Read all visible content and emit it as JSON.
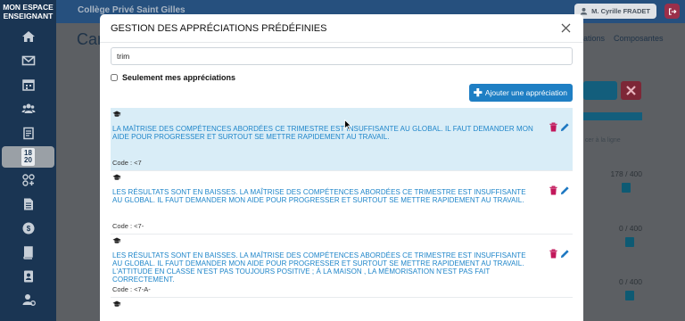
{
  "brand": {
    "line1": "MON ESPACE",
    "line2": "ENSEIGNANT"
  },
  "sidebar": {
    "date_badge": {
      "day": "18",
      "month": "20"
    },
    "items": [
      {
        "icon": "home-icon"
      },
      {
        "icon": "mail-icon"
      },
      {
        "icon": "calendar-icon"
      },
      {
        "icon": "users-icon"
      },
      {
        "icon": "clipboard-icon"
      },
      {
        "icon": "date-badge"
      },
      {
        "icon": "grid-icon"
      },
      {
        "icon": "document-icon"
      },
      {
        "icon": "coin-icon"
      },
      {
        "icon": "book-icon"
      },
      {
        "icon": "contact-icon"
      },
      {
        "icon": "user-settings-icon"
      }
    ]
  },
  "topbar": {
    "college": "Collège Privé Saint Gilles",
    "user": "M. Cyrille FRADET"
  },
  "background": {
    "page_title": "Car",
    "tab_appreciations": "ations",
    "tab_composantes": "Composantes",
    "line_hint": "cer à la ligne",
    "scores": [
      "178 / 400",
      "0 / 400",
      "0 / 400"
    ],
    "colors": {
      "teal": "#135e7c",
      "red": "#7d2737",
      "navy": "#1a3553"
    }
  },
  "modal": {
    "title": "GESTION DES APPRÉCIATIONS PRÉDÉFINIES",
    "search_value": "trim",
    "only_mine_label": "Seulement mes appréciations",
    "only_mine_checked": false,
    "add_button": "Ajouter une appréciation",
    "colors": {
      "accent": "#1f7fc4",
      "text": "#1e85c9",
      "selected_bg": "#d9edf7",
      "trash": "#c2185b"
    },
    "entries": [
      {
        "text": "LA MAÎTRISE DES COMPÉTENCES ABORDÉES CE TRIMESTRE EST INSUFFISANTE AU GLOBAL. IL FAUT DEMANDER MON AIDE POUR PROGRESSER ET SURTOUT SE METTRE RAPIDEMENT AU TRAVAIL.",
        "code": "Code : <7",
        "selected": true
      },
      {
        "text": "LES RÉSULTATS SONT EN BAISSES. LA MAÎTRISE DES COMPÉTENCES ABORDÉES CE TRIMESTRE EST INSUFFISANTE AU GLOBAL. IL FAUT DEMANDER MON AIDE POUR PROGRESSER ET SURTOUT SE METTRE RAPIDEMENT AU TRAVAIL.",
        "code": "Code : <7-",
        "selected": false
      },
      {
        "text": "LES RÉSULTATS SONT EN BAISSES. LA MAÎTRISE DES COMPÉTENCES ABORDÉES CE TRIMESTRE EST INSUFFISANTE AU GLOBAL. IL FAUT DEMANDER MON AIDE POUR PROGRESSER ET SURTOUT SE METTRE RAPIDEMENT AU TRAVAIL. L'ATTITUDE EN CLASSE N'EST PAS TOUJOURS POSITIVE ; À LA MAISON , LA MÉMORISATION N'EST PAS FAIT CORRECTEMENT.",
        "code": "Code : <7-A-",
        "selected": false
      }
    ]
  }
}
